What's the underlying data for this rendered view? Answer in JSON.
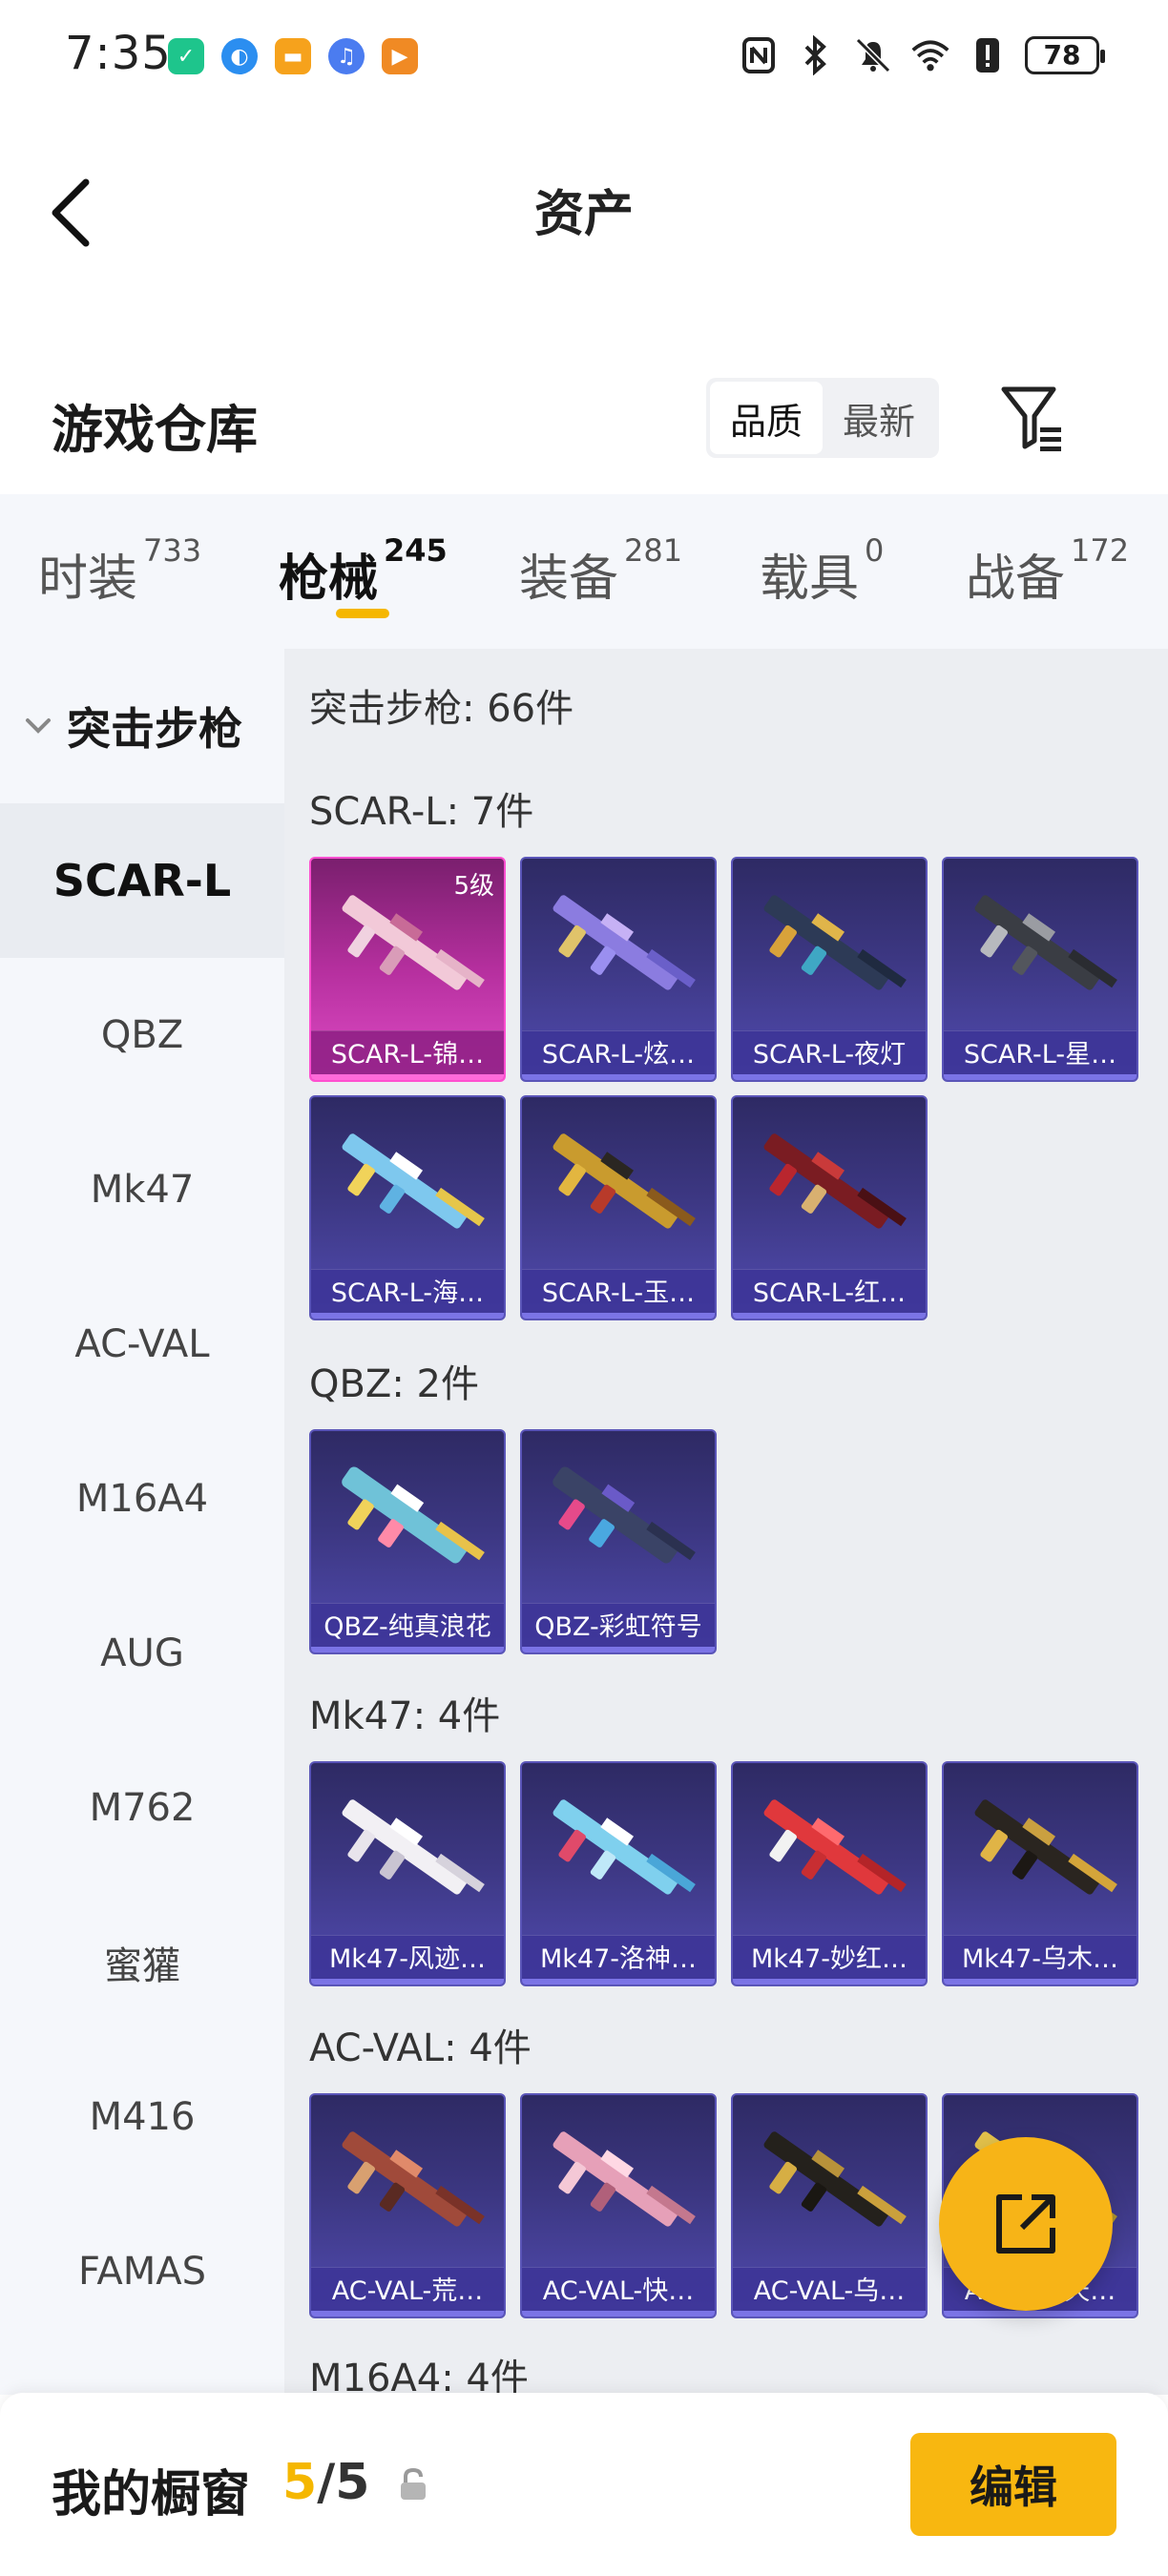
{
  "status_bar": {
    "time": "7:35",
    "battery": "78",
    "app_icons": [
      "shield-app-icon",
      "browser-app-icon",
      "folder-app-icon",
      "music-app-icon",
      "video-app-icon"
    ]
  },
  "header": {
    "title": "资产"
  },
  "warehouse": {
    "title": "游戏仓库",
    "sort_options": [
      {
        "label": "品质",
        "active": true
      },
      {
        "label": "最新",
        "active": false
      }
    ]
  },
  "category_tabs": [
    {
      "label": "时装",
      "count": "733"
    },
    {
      "label": "枪械",
      "count": "245",
      "active": true
    },
    {
      "label": "装备",
      "count": "281"
    },
    {
      "label": "载具",
      "count": "0"
    },
    {
      "label": "战备",
      "count": "172"
    }
  ],
  "sidebar": {
    "group": "突击步枪",
    "items": [
      "SCAR-L",
      "QBZ",
      "Mk47",
      "AC-VAL",
      "M16A4",
      "AUG",
      "M762",
      "蜜獾",
      "M416",
      "FAMAS"
    ],
    "active_index": 0
  },
  "content": {
    "header": "突击步枪: 66件",
    "sections": [
      {
        "title": "SCAR-L: 7件",
        "items": [
          {
            "name": "SCAR-L-锦…",
            "level": "5级",
            "rarity": "gold"
          },
          {
            "name": "SCAR-L-炫…"
          },
          {
            "name": "SCAR-L-夜灯"
          },
          {
            "name": "SCAR-L-星…"
          },
          {
            "name": "SCAR-L-海…"
          },
          {
            "name": "SCAR-L-玉…"
          },
          {
            "name": "SCAR-L-红…"
          }
        ]
      },
      {
        "title": "QBZ: 2件",
        "items": [
          {
            "name": "QBZ-纯真浪花"
          },
          {
            "name": "QBZ-彩虹符号"
          }
        ]
      },
      {
        "title": "Mk47: 4件",
        "items": [
          {
            "name": "Mk47-风迹…"
          },
          {
            "name": "Mk47-洛神…"
          },
          {
            "name": "Mk47-妙红…"
          },
          {
            "name": "Mk47-乌木…"
          }
        ]
      },
      {
        "title": "AC-VAL: 4件",
        "items": [
          {
            "name": "AC-VAL-荒…"
          },
          {
            "name": "AC-VAL-快…"
          },
          {
            "name": "AC-VAL-乌…"
          },
          {
            "name": "AC-VAL-天…"
          }
        ]
      },
      {
        "title": "M16A4: 4件",
        "items": []
      }
    ]
  },
  "bottom_bar": {
    "title": "我的橱窗",
    "count_current": "5",
    "count_separator": "/",
    "count_total": "5",
    "edit_label": "编辑"
  },
  "colors": {
    "accent": "#f7b417",
    "card_bg": "#3c3782",
    "card_gold": "#b52f9e"
  }
}
